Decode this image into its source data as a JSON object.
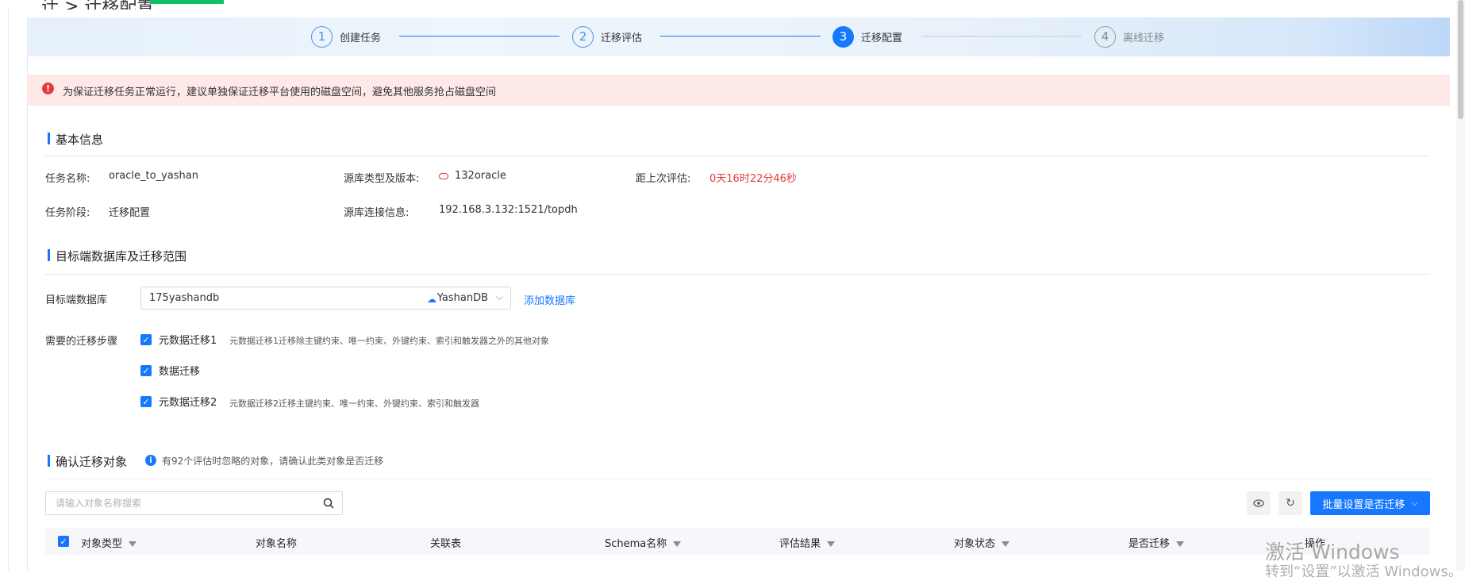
{
  "header": {
    "breadcrumb": "迁 > 迁移配置"
  },
  "steps": [
    {
      "num": "1",
      "label": "创建任务"
    },
    {
      "num": "2",
      "label": "迁移评估"
    },
    {
      "num": "3",
      "label": "迁移配置"
    },
    {
      "num": "4",
      "label": "离线迁移"
    }
  ],
  "alert": {
    "icon": "!",
    "text": "为保证迁移任务正常运行，建议单独保证迁移平台使用的磁盘空间，避免其他服务抢占磁盘空间"
  },
  "basic": {
    "title": "基本信息",
    "task_name_label": "任务名称:",
    "task_name": "oracle_to_yashan",
    "source_type_label": "源库类型及版本:",
    "source_type": "132oracle",
    "last_eval_label": "距上次评估:",
    "last_eval": "0天16时22分46秒",
    "stage_label": "任务阶段:",
    "stage": "迁移配置",
    "conn_label": "源库连接信息:",
    "conn": "192.168.3.132:1521/topdh"
  },
  "target": {
    "title": "目标端数据库及迁移范围",
    "db_label": "目标端数据库",
    "db_value": "175yashandb",
    "db_type": "YashanDB",
    "add_link": "添加数据库",
    "steps_label": "需要的迁移步骤",
    "options": [
      {
        "label": "元数据迁移1",
        "desc": "元数据迁移1迁移除主键约束、唯一约束、外键约束、索引和触发器之外的其他对象"
      },
      {
        "label": "数据迁移",
        "desc": ""
      },
      {
        "label": "元数据迁移2",
        "desc": "元数据迁移2迁移主键约束、唯一约束、外键约束、索引和触发器"
      }
    ]
  },
  "confirm": {
    "title": "确认迁移对象",
    "hint": "有92个评估时忽略的对象，请确认此类对象是否迁移",
    "search_placeholder": "请输入对象名称搜索",
    "batch_button": "批量设置是否迁移",
    "columns": [
      "对象类型",
      "对象名称",
      "关联表",
      "Schema名称",
      "评估结果",
      "对象状态",
      "是否迁移",
      "操作"
    ]
  },
  "watermark": {
    "line1": "激活 Windows",
    "line2": "转到“设置”以激活 Windows。"
  }
}
